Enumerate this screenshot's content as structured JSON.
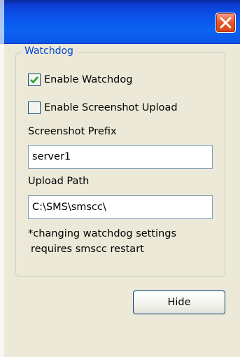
{
  "titlebar": {
    "close_icon": "close-icon"
  },
  "watchdog": {
    "legend": "Watchdog",
    "enable_watchdog": {
      "label": "Enable Watchdog",
      "checked": true
    },
    "enable_screenshot_upload": {
      "label": "Enable Screenshot Upload",
      "checked": false
    },
    "screenshot_prefix": {
      "label": "Screenshot Prefix",
      "value": "server1"
    },
    "upload_path": {
      "label": "Upload Path",
      "value": "C:\\SMS\\smscc\\"
    },
    "note_line1": "*changing watchdog settings",
    "note_line2": "requires smscc restart"
  },
  "actions": {
    "hide_label": "Hide"
  },
  "colors": {
    "title_blue": "#0a54ec",
    "close_red": "#e8582a",
    "legend_blue": "#0046d5",
    "check_green": "#21a121",
    "dialog_bg": "#ece9d8"
  }
}
